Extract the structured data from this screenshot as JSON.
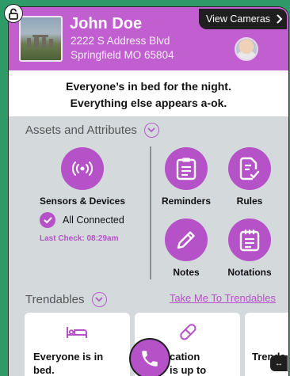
{
  "header": {
    "name": "John Doe",
    "address_line1": "2222 S Address Blvd",
    "address_line2": "Springfield MO 65804",
    "view_cameras_label": "View Cameras"
  },
  "status": {
    "line1": "Everyone’s in bed for the night.",
    "line2": "Everything else appears a-ok."
  },
  "assets": {
    "title": "Assets and Attributes",
    "sensors_label": "Sensors & Devices",
    "connection_status": "All Connected",
    "last_check": "Last Check: 08:29am",
    "reminders_label": "Reminders",
    "rules_label": "Rules",
    "notes_label": "Notes",
    "notations_label": "Notations"
  },
  "trendables": {
    "title": "Trendables",
    "link": "Take Me To Trendables",
    "cards": [
      {
        "line1": "Everyone is in",
        "line2": "bed."
      },
      {
        "line1": "cation",
        "line2": "is up to"
      },
      {
        "line1": "Trenda",
        "line2": ""
      }
    ]
  },
  "colors": {
    "accent": "#b552c7",
    "header": "#c15fd0",
    "background": "#2e9a68"
  },
  "icons": [
    "lock-open-icon",
    "chevron-right-icon",
    "chevron-down-icon",
    "sensor-signal-icon",
    "checkmark-icon",
    "clipboard-list-icon",
    "clipboard-check-icon",
    "pencil-icon",
    "notepad-icon",
    "bed-icon",
    "pill-icon",
    "phone-icon",
    "expand-arrows-icon"
  ]
}
